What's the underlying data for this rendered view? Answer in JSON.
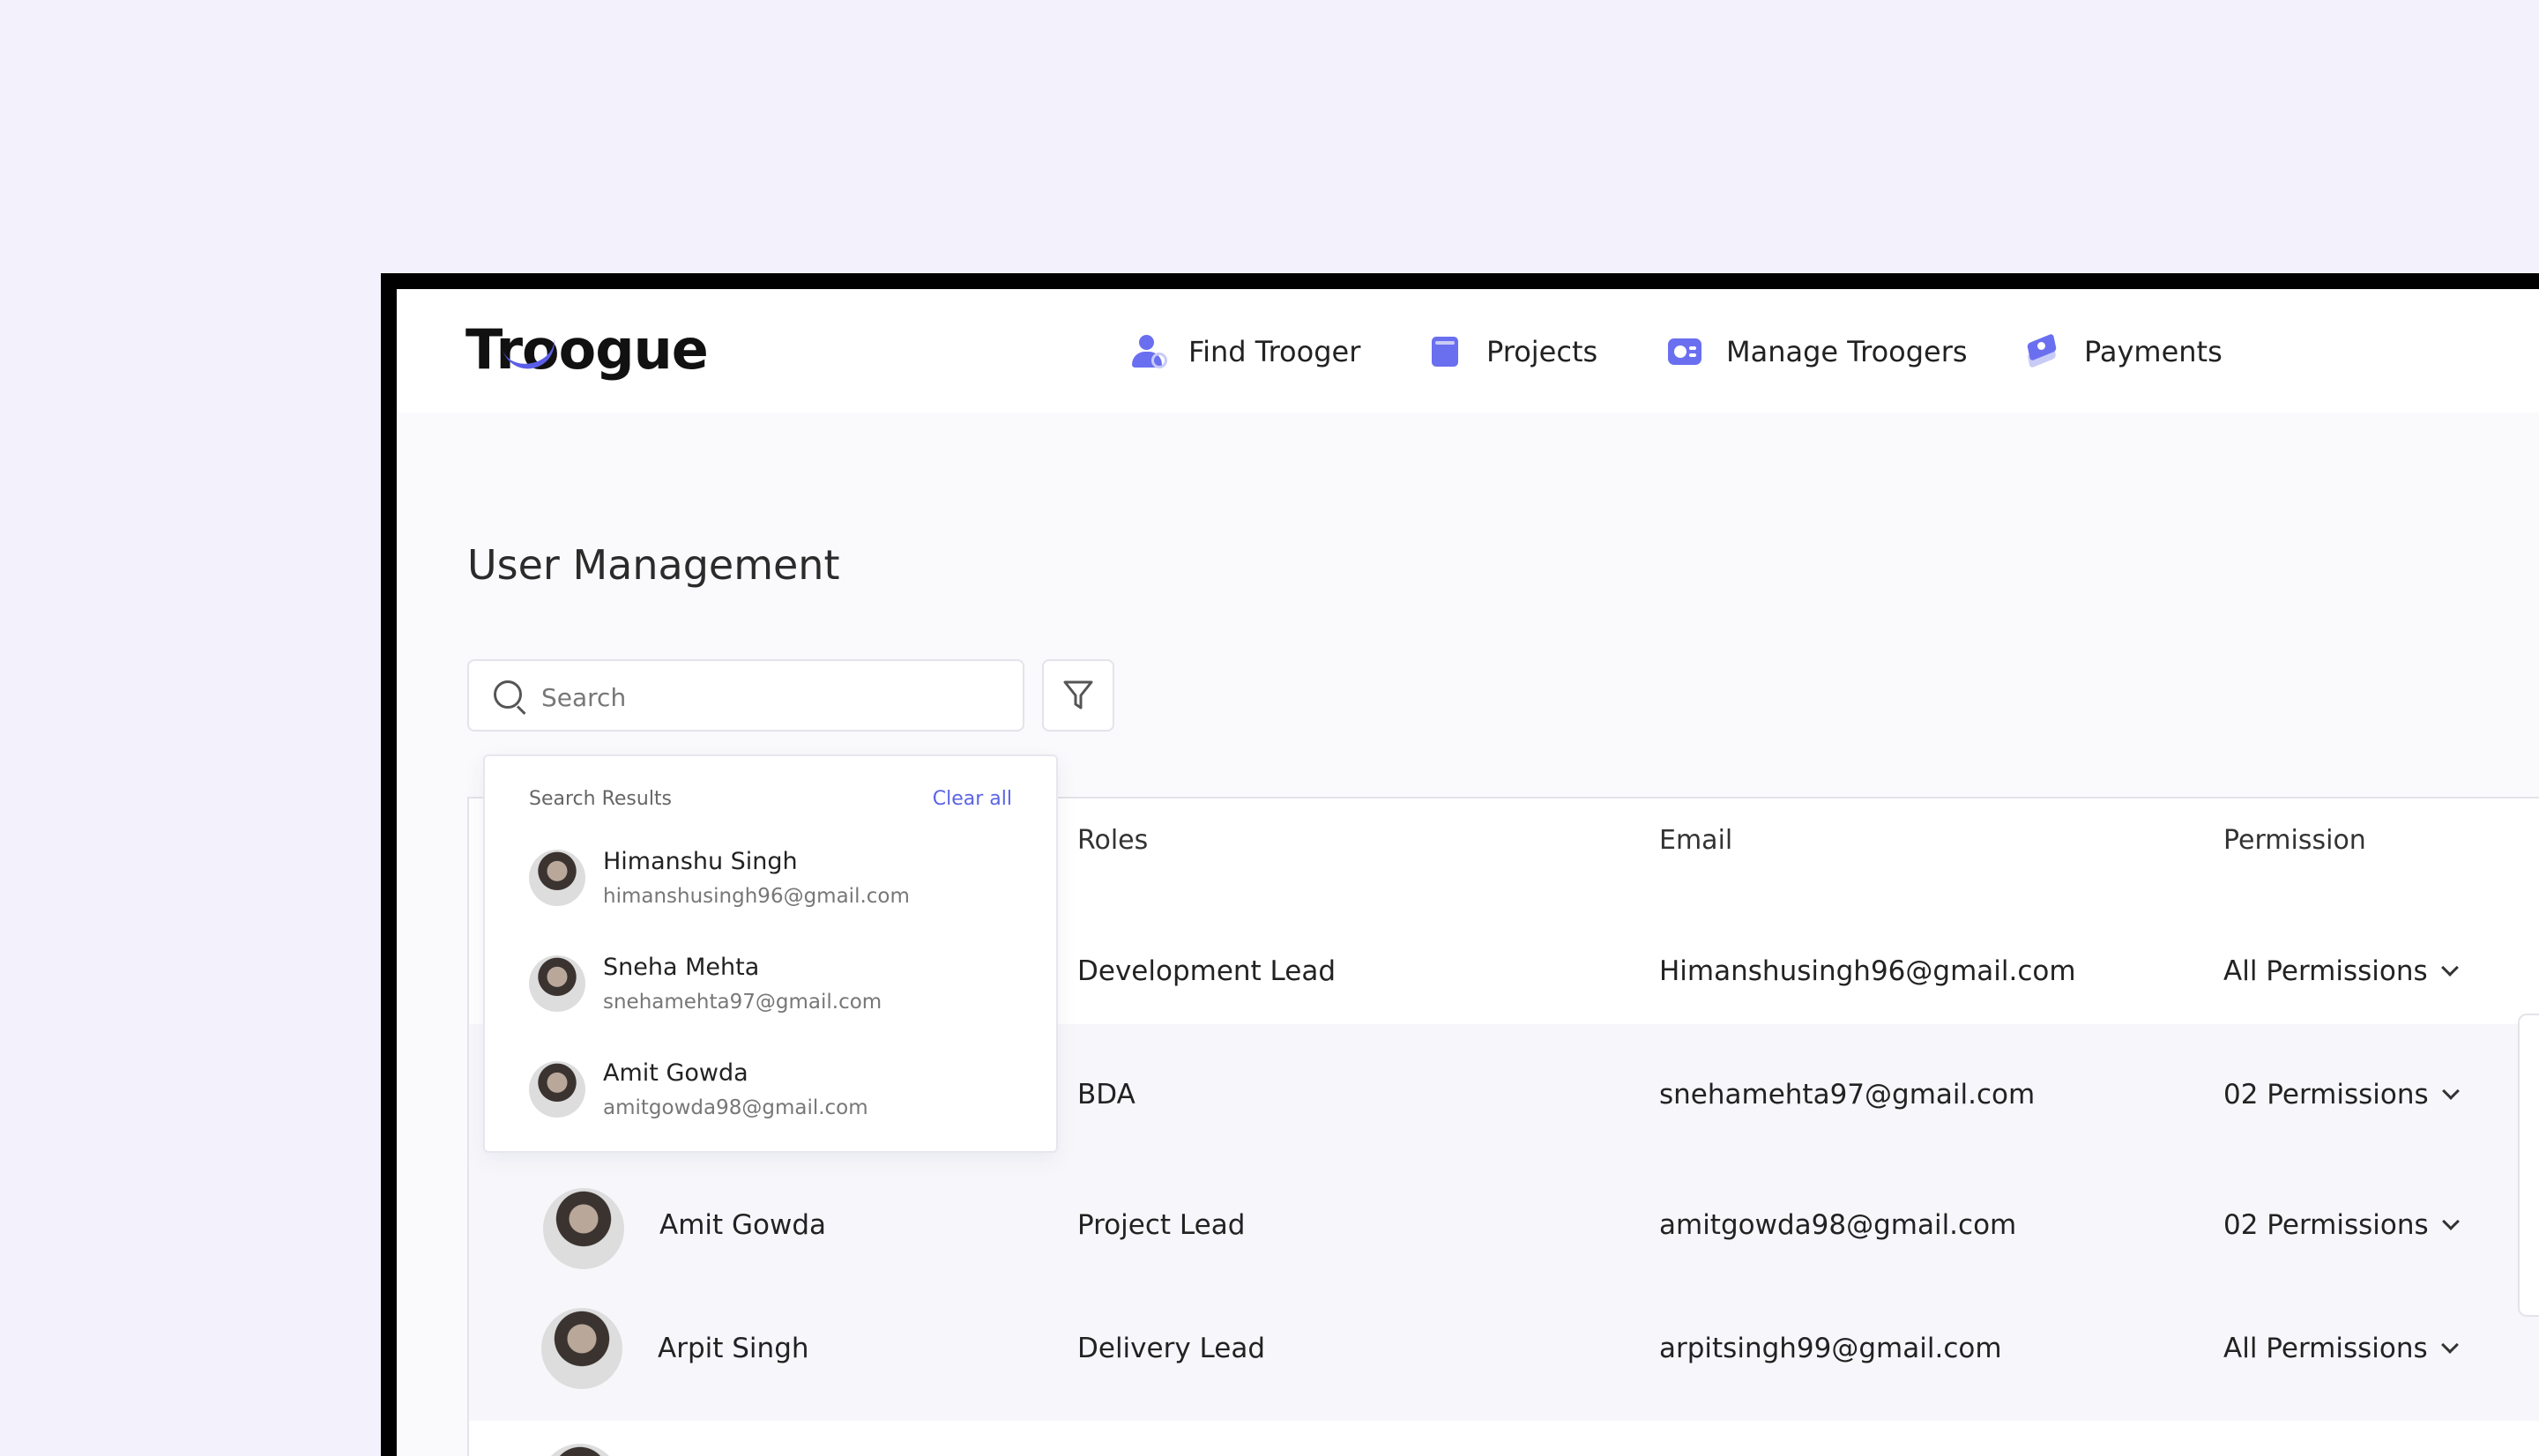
{
  "nav": {
    "logo": "Troogue",
    "items": [
      {
        "label": "Find Trooger",
        "icon": "user-search-icon"
      },
      {
        "label": "Projects",
        "icon": "clipboard-icon"
      },
      {
        "label": "Manage Troogers",
        "icon": "id-card-icon"
      },
      {
        "label": "Payments",
        "icon": "money-stack-icon"
      }
    ]
  },
  "page": {
    "title": "User Management"
  },
  "search": {
    "placeholder": "Search",
    "value": ""
  },
  "dropdown": {
    "heading": "Search Results",
    "clear_label": "Clear all",
    "results": [
      {
        "name": "Himanshu Singh",
        "email": "himanshusingh96@gmail.com"
      },
      {
        "name": "Sneha Mehta",
        "email": "snehamehta97@gmail.com"
      },
      {
        "name": "Amit Gowda",
        "email": "amitgowda98@gmail.com"
      }
    ]
  },
  "table": {
    "headers": [
      "Roles",
      "Email",
      "Permission"
    ],
    "rows": [
      {
        "name": "",
        "role": "Development Lead",
        "email": "Himanshusingh96@gmail.com",
        "permission": "All Permissions"
      },
      {
        "name": "",
        "role": "BDA",
        "email": "snehamehta97@gmail.com",
        "permission": "02 Permissions"
      },
      {
        "name": "Amit Gowda",
        "role": "Project Lead",
        "email": "amitgowda98@gmail.com",
        "permission": "02 Permissions"
      },
      {
        "name": "Arpit Singh",
        "role": "Delivery Lead",
        "email": "arpitsingh99@gmail.com",
        "permission": "All Permissions"
      }
    ]
  },
  "colors": {
    "accent": "#6a6ff0",
    "background": "#f3f2fc",
    "link": "#5b63e6"
  }
}
